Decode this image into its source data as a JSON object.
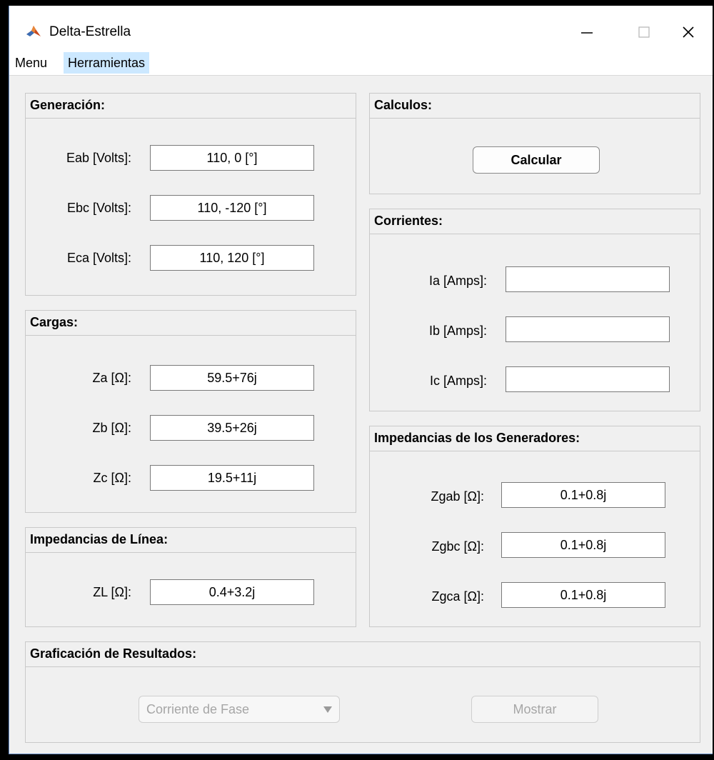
{
  "window": {
    "title": "Delta-Estrella"
  },
  "menu": {
    "items": [
      {
        "label": "Menu"
      },
      {
        "label": "Herramientas"
      }
    ]
  },
  "panels": {
    "generacion": {
      "title": "Generación:",
      "fields": [
        {
          "label": "Eab [Volts]:",
          "value": "110, 0 [°]"
        },
        {
          "label": "Ebc [Volts]:",
          "value": "110, -120 [°]"
        },
        {
          "label": "Eca [Volts]:",
          "value": "110, 120 [°]"
        }
      ]
    },
    "cargas": {
      "title": "Cargas:",
      "fields": [
        {
          "label": "Za [Ω]:",
          "value": "59.5+76j"
        },
        {
          "label": "Zb [Ω]:",
          "value": "39.5+26j"
        },
        {
          "label": "Zc [Ω]:",
          "value": "19.5+11j"
        }
      ]
    },
    "linea": {
      "title": "Impedancias de Línea:",
      "fields": [
        {
          "label": "ZL [Ω]:",
          "value": "0.4+3.2j"
        }
      ]
    },
    "calculos": {
      "title": "Calculos:",
      "button_label": "Calcular"
    },
    "corrientes": {
      "title": "Corrientes:",
      "fields": [
        {
          "label": "Ia [Amps]:",
          "value": ""
        },
        {
          "label": "Ib [Amps]:",
          "value": ""
        },
        {
          "label": "Ic [Amps]:",
          "value": ""
        }
      ]
    },
    "generadores": {
      "title": "Impedancias de los Generadores:",
      "fields": [
        {
          "label": "Zgab [Ω]:",
          "value": "0.1+0.8j"
        },
        {
          "label": "Zgbc [Ω]:",
          "value": "0.1+0.8j"
        },
        {
          "label": "Zgca [Ω]:",
          "value": "0.1+0.8j"
        }
      ]
    },
    "graficacion": {
      "title": "Graficación de Resultados:",
      "select_value": "Corriente de Fase",
      "button_label": "Mostrar"
    }
  },
  "colors": {
    "accent": "#cce8ff",
    "window_bg": "#f0f0f0",
    "disabled_text": "#a6a6a6"
  }
}
